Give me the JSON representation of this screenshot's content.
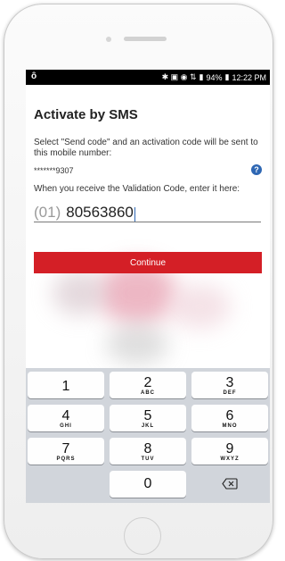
{
  "status_bar": {
    "left_icon": "ȏ",
    "icons": "✱ ▣ ◉ ⇅",
    "signal": "▮",
    "battery": "94%",
    "time": "12:22 PM"
  },
  "screen": {
    "title": "Activate by SMS",
    "description": "Select \"Send code\" and an activation code will be sent to this mobile number:",
    "masked_number": "*******9307",
    "help_label": "?",
    "enter_label": "When you receive the Validation Code, enter it here:",
    "phone_prefix": "(01)",
    "phone_value": "80563860",
    "continue_label": "Continue"
  },
  "keyboard": {
    "keys": [
      {
        "num": "1",
        "letters": ""
      },
      {
        "num": "2",
        "letters": "ABC"
      },
      {
        "num": "3",
        "letters": "DEF"
      },
      {
        "num": "4",
        "letters": "GHI"
      },
      {
        "num": "5",
        "letters": "JKL"
      },
      {
        "num": "6",
        "letters": "MNO"
      },
      {
        "num": "7",
        "letters": "PQRS"
      },
      {
        "num": "8",
        "letters": "TUV"
      },
      {
        "num": "9",
        "letters": "WXYZ"
      },
      {
        "num": "0",
        "letters": ""
      }
    ],
    "backspace_icon": "backspace-icon"
  },
  "colors": {
    "accent_red": "#d41f26",
    "help_blue": "#2e67b3",
    "keyboard_bg": "#d1d5db"
  }
}
